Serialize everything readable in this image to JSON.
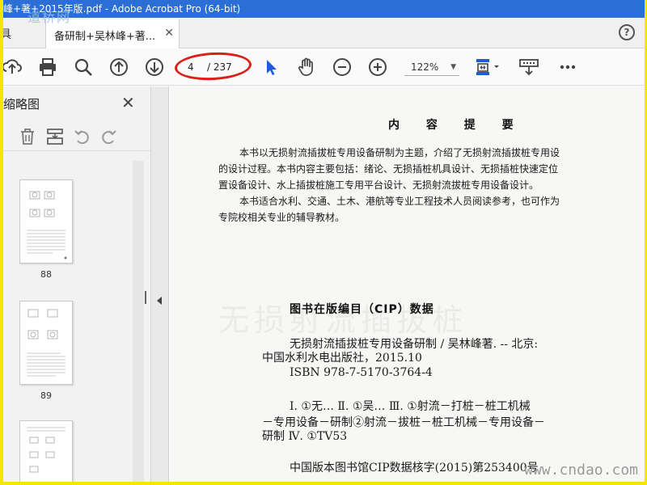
{
  "window": {
    "title": "峰+著+2015年版.pdf - Adobe Acrobat Pro (64-bit)",
    "watermark_top": "道桥网"
  },
  "tabs": {
    "home_label": "具",
    "active_label": "备研制+吴林峰+著..."
  },
  "toolbar": {
    "current_page": "4",
    "total_pages": "/ 237",
    "zoom": "122%"
  },
  "sidebar": {
    "title": "缩略图",
    "thumbnails": [
      {
        "page": "88"
      },
      {
        "page": "89"
      }
    ]
  },
  "document": {
    "heading": "内 容 提 要",
    "abstract_lines": [
      "本书以无损射流插拔桩专用设备研制为主题，介绍了无损射流插拔桩专用设",
      "的设计过程。本书内容主要包括：绪论、无损插桩机具设计、无损插桩快速定位",
      "置设备设计、水上插拔桩施工专用平台设计、无损射流拔桩专用设备设计。",
      "本书适合水利、交通、土木、港航等专业工程技术人员阅读参考，也可作为",
      "专院校相关专业的辅导教材。"
    ],
    "cip_heading": "图书在版编目（CIP）数据",
    "cip_lines": [
      "无损射流插拔桩专用设备研制 / 吴林峰著. -- 北京:",
      "中国水利水电出版社，2015.10",
      "ISBN 978-7-5170-3764-4",
      "Ⅰ. ①无… Ⅱ. ①吴… Ⅲ. ①射流－打桩－桩工机械",
      "－专用设备－研制②射流－拔桩－桩工机械－专用设备－",
      "研制 Ⅳ. ①TV53",
      "中国版本图书馆CIP数据核字(2015)第253400号"
    ],
    "watermark": "www.cndao.com"
  },
  "colors": {
    "titlebar": "#2b6fd6",
    "frame_border": "#f4e600",
    "annotation_oval": "#d9211a",
    "select_cursor": "#1e5bd6"
  }
}
